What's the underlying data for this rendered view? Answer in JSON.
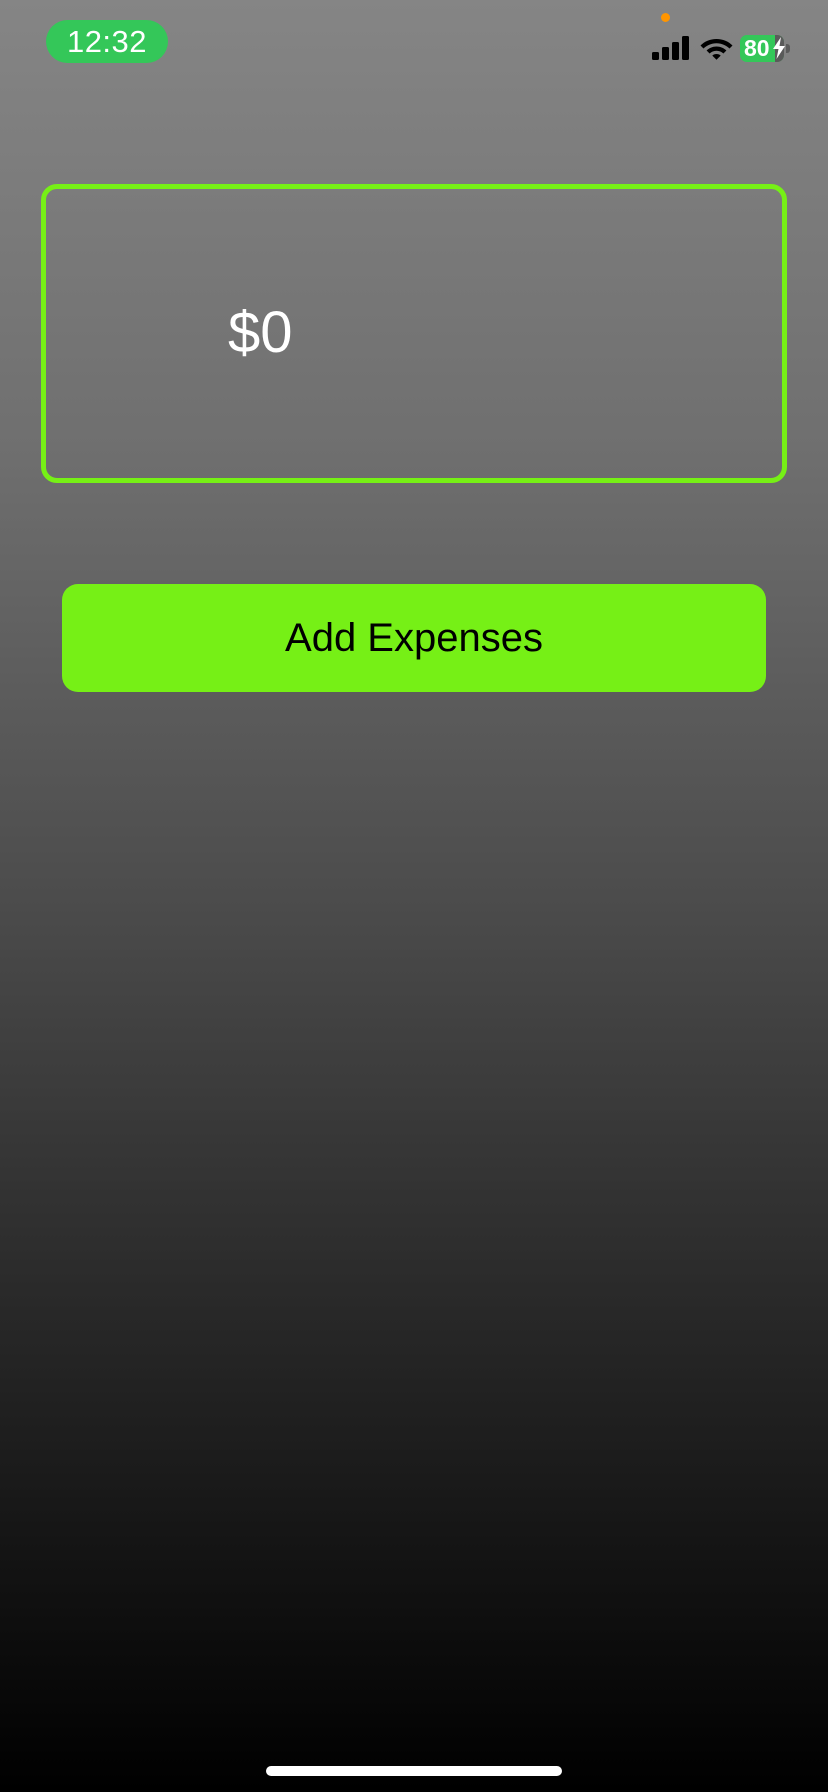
{
  "status_bar": {
    "time": "12:32",
    "battery_level": "80",
    "time_pill_color": "#34c759",
    "mic_indicator_color": "#ff9500",
    "icons": [
      "signal-icon",
      "wifi-icon",
      "battery-icon",
      "charging-bolt-icon"
    ]
  },
  "summary": {
    "total": "$0"
  },
  "actions": {
    "add_expenses_label": "Add Expenses"
  },
  "colors": {
    "accent": "#76f016",
    "text_primary": "#ffffff",
    "button_text": "#000000"
  }
}
